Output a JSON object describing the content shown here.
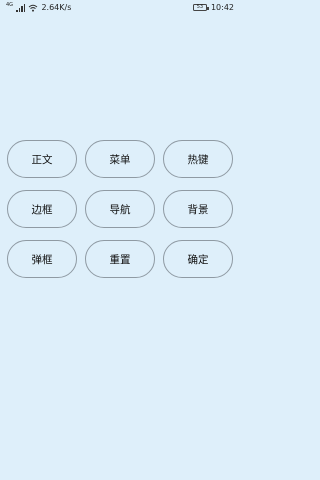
{
  "status_bar": {
    "network_type": "4G",
    "speed": "2.64K/s",
    "battery_level": "53",
    "time": "10:42"
  },
  "buttons": [
    {
      "label": "正文"
    },
    {
      "label": "菜单"
    },
    {
      "label": "热键"
    },
    {
      "label": "边框"
    },
    {
      "label": "导航"
    },
    {
      "label": "背景"
    },
    {
      "label": "弹框"
    },
    {
      "label": "重置"
    },
    {
      "label": "确定"
    }
  ]
}
